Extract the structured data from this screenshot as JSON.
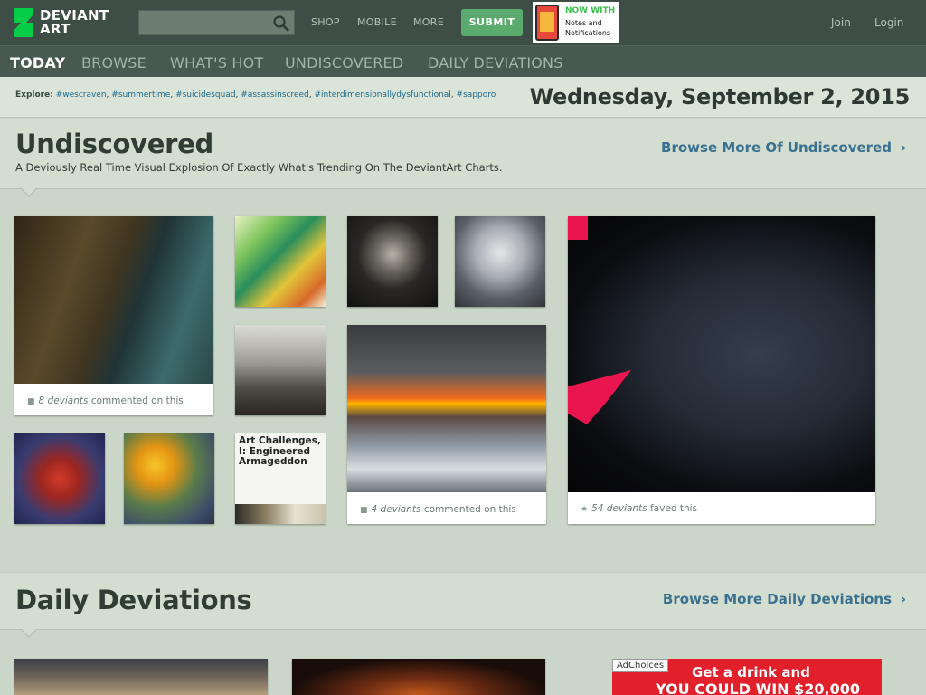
{
  "topbar": {
    "logo_line1": "DEVIANT",
    "logo_line2": "ART",
    "links": [
      "SHOP",
      "MOBILE",
      "MORE"
    ],
    "submit_label": "SUBMIT",
    "promo_line1": "NOW WITH",
    "promo_line2": "Notes and Notifications",
    "join": "Join",
    "login": "Login"
  },
  "nav": {
    "tabs": [
      "TODAY",
      "BROWSE",
      "WHAT'S HOT",
      "UNDISCOVERED",
      "DAILY DEVIATIONS"
    ]
  },
  "explore": {
    "label": "Explore:",
    "tags": [
      "#wescraven",
      "#summertime",
      "#suicidesquad",
      "#assassinscreed",
      "#interdimensionallydysfunctional",
      "#sapporo"
    ]
  },
  "date": "Wednesday, September 2, 2015",
  "undiscovered": {
    "title": "Undiscovered",
    "subtitle": "A Deviously Real Time Visual Explosion Of Exactly What's Trending On The DeviantArt Charts.",
    "browse_more": "Browse More Of Undiscovered",
    "meta1_count": "8 deviants",
    "meta1_text": "commented on this",
    "meta2_count": "4 deviants",
    "meta2_text": "commented on this",
    "meta3_count": "54 deviants",
    "meta3_text": "faved this",
    "journal_title": "Art Challenges, I: Engineered Armageddon"
  },
  "daily": {
    "title": "Daily Deviations",
    "browse_more": "Browse More Daily Deviations"
  },
  "ad": {
    "choices": "AdChoices",
    "line1": "Get a drink and",
    "line2": "YOU COULD WIN $20,000"
  },
  "colors": {
    "topbar": "#3e4d45",
    "accent_green": "#5bab6f",
    "link_blue": "#3a7090",
    "page_bg": "#cad6c7"
  }
}
